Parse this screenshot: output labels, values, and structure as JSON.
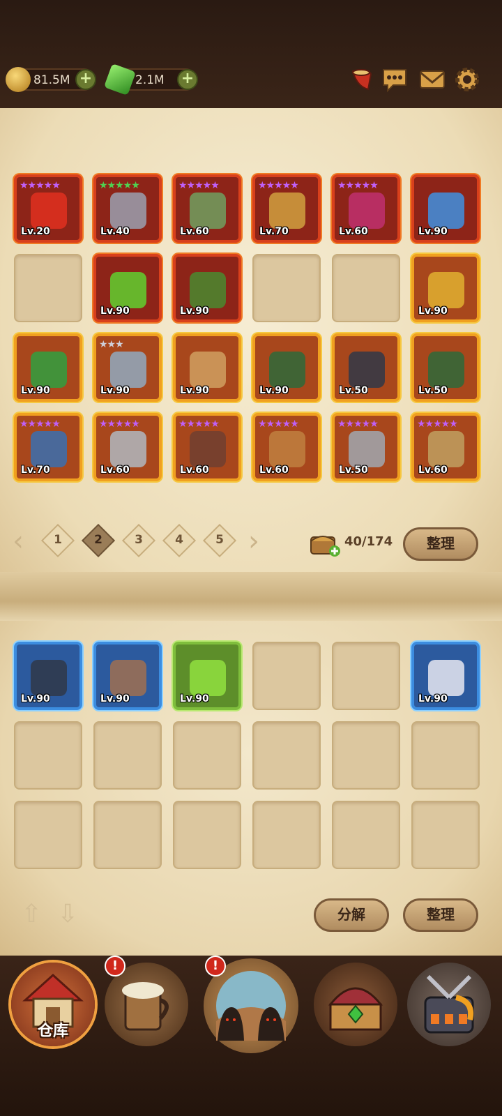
{
  "resources": {
    "gold": "81.5M",
    "gems": "2.1M"
  },
  "warehouse": {
    "rows": [
      [
        {
          "rarity": "red",
          "stars": "★★★★★",
          "star_color": "purple",
          "level": "Lv.20",
          "item_color": "#e03020"
        },
        {
          "rarity": "red",
          "stars": "★★★★★",
          "star_color": "green",
          "level": "Lv.40",
          "item_color": "#9aa0b0"
        },
        {
          "rarity": "red",
          "stars": "★★★★★",
          "star_color": "purple",
          "level": "Lv.60",
          "item_color": "#70a060"
        },
        {
          "rarity": "red",
          "stars": "★★★★★",
          "star_color": "purple",
          "level": "Lv.70",
          "item_color": "#d0a040"
        },
        {
          "rarity": "red",
          "stars": "★★★★★",
          "star_color": "purple",
          "level": "Lv.60",
          "item_color": "#c03070"
        },
        {
          "rarity": "red",
          "stars": "",
          "star_color": "purple",
          "level": "Lv.90",
          "item_color": "#4090e0"
        }
      ],
      [
        {
          "rarity": "empty"
        },
        {
          "rarity": "red",
          "stars": "",
          "star_color": "purple",
          "level": "Lv.90",
          "item_color": "#60d030"
        },
        {
          "rarity": "red",
          "stars": "",
          "star_color": "purple",
          "level": "Lv.90",
          "item_color": "#4a8a30"
        },
        {
          "rarity": "empty"
        },
        {
          "rarity": "empty"
        },
        {
          "rarity": "orange",
          "stars": "",
          "star_color": "purple",
          "level": "Lv.90",
          "item_color": "#e0b030"
        }
      ],
      [
        {
          "rarity": "orange",
          "stars": "",
          "star_color": "purple",
          "level": "Lv.90",
          "item_color": "#30a040"
        },
        {
          "rarity": "orange",
          "stars": "★★★",
          "star_color": "silver",
          "level": "Lv.90",
          "item_color": "#90aac0"
        },
        {
          "rarity": "orange",
          "stars": "",
          "star_color": "purple",
          "level": "Lv.90",
          "item_color": "#d0a060"
        },
        {
          "rarity": "orange",
          "stars": "",
          "star_color": "purple",
          "level": "Lv.90",
          "item_color": "#2e6a3a"
        },
        {
          "rarity": "orange",
          "stars": "",
          "star_color": "purple",
          "level": "Lv.50",
          "item_color": "#303848"
        },
        {
          "rarity": "orange",
          "stars": "",
          "star_color": "purple",
          "level": "Lv.50",
          "item_color": "#2e6a3a"
        }
      ],
      [
        {
          "rarity": "orange",
          "stars": "★★★★★",
          "star_color": "purple",
          "level": "Lv.70",
          "item_color": "#3a70b0"
        },
        {
          "rarity": "orange",
          "stars": "★★★★★",
          "star_color": "purple",
          "level": "Lv.60",
          "item_color": "#b0b8c0"
        },
        {
          "rarity": "orange",
          "stars": "★★★★★",
          "star_color": "purple",
          "level": "Lv.60",
          "item_color": "#704030"
        },
        {
          "rarity": "orange",
          "stars": "★★★★★",
          "star_color": "purple",
          "level": "Lv.60",
          "item_color": "#c08040"
        },
        {
          "rarity": "orange",
          "stars": "★★★★★",
          "star_color": "purple",
          "level": "Lv.50",
          "item_color": "#a0a8b0"
        },
        {
          "rarity": "orange",
          "stars": "★★★★★",
          "star_color": "purple",
          "level": "Lv.60",
          "item_color": "#c0a060"
        }
      ]
    ],
    "pages": [
      "1",
      "2",
      "3",
      "4",
      "5"
    ],
    "active_page": "2",
    "capacity": "40/174",
    "sort_label": "整理"
  },
  "selection": {
    "rows": [
      [
        {
          "rarity": "blue",
          "level": "Lv.90",
          "item_color": "#303848"
        },
        {
          "rarity": "blue",
          "level": "Lv.90",
          "item_color": "#a07050"
        },
        {
          "rarity": "green",
          "level": "Lv.90",
          "item_color": "#90e040"
        },
        {
          "rarity": "empty"
        },
        {
          "rarity": "empty"
        },
        {
          "rarity": "blue",
          "level": "Lv.90",
          "item_color": "#e8e8f0"
        }
      ],
      [
        {
          "rarity": "empty"
        },
        {
          "rarity": "empty"
        },
        {
          "rarity": "empty"
        },
        {
          "rarity": "empty"
        },
        {
          "rarity": "empty"
        },
        {
          "rarity": "empty"
        }
      ],
      [
        {
          "rarity": "empty"
        },
        {
          "rarity": "empty"
        },
        {
          "rarity": "empty"
        },
        {
          "rarity": "empty"
        },
        {
          "rarity": "empty"
        },
        {
          "rarity": "empty"
        }
      ]
    ],
    "decompose_label": "分解",
    "sort_label": "整理"
  },
  "nav": {
    "warehouse_label": "仓库",
    "alert_mark": "!"
  },
  "colors": {
    "gold": "#d8a838",
    "gem": "#58c040",
    "accent_brown": "#7a5a3a"
  }
}
